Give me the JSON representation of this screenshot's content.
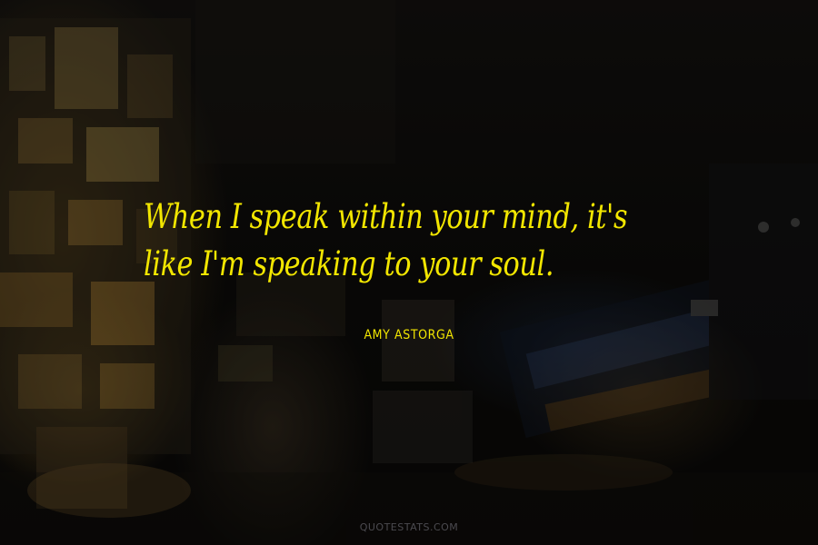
{
  "quote": {
    "lines": [
      "When I speak within your mind, it's",
      "like I'm speaking to your soul."
    ],
    "color": "#f2e600"
  },
  "author": "AMY ASTORGA",
  "watermark": "QUOTESTATS.COM",
  "background": "dark night city street with lit billboards"
}
